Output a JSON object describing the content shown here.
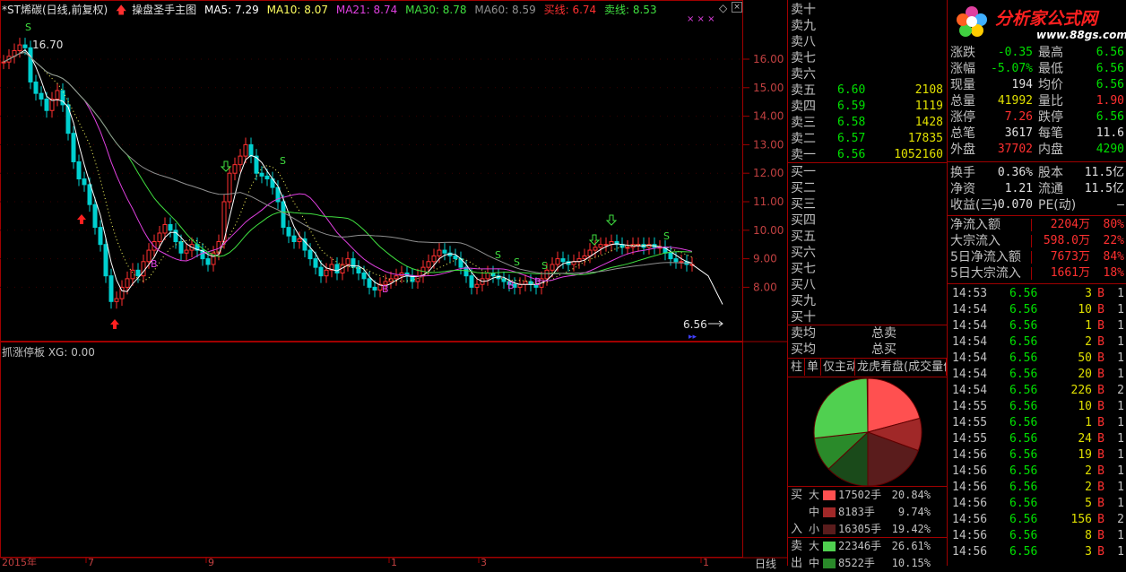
{
  "header": {
    "stock": "*ST烯碳(日线,前复权)",
    "indicator": "操盘圣手主图",
    "ma5": "MA5: 7.29",
    "ma10": "MA10: 8.07",
    "ma21": "MA21: 8.74",
    "ma30": "MA30: 8.78",
    "ma60": "MA60: 8.59",
    "buyline": "买线: 6.74",
    "sellline": "卖线: 8.53",
    "indicator_icon": "arrow-up-icon"
  },
  "sub_header": "抓涨停板  XG: 0.00",
  "price_axis": [
    "16.00",
    "15.00",
    "14.00",
    "13.00",
    "12.00",
    "11.00",
    "10.00",
    "9.00",
    "8.00"
  ],
  "annotations": {
    "high": "16.70",
    "last": "6.56"
  },
  "bottom_labels": {
    "date_left": "2015年",
    "marks": [
      "7",
      "9",
      "1",
      "3",
      "1"
    ],
    "period": "日线"
  },
  "order_book": {
    "sells": [
      {
        "label": "卖十",
        "price": "",
        "vol": ""
      },
      {
        "label": "卖九",
        "price": "",
        "vol": ""
      },
      {
        "label": "卖八",
        "price": "",
        "vol": ""
      },
      {
        "label": "卖七",
        "price": "",
        "vol": ""
      },
      {
        "label": "卖六",
        "price": "",
        "vol": ""
      },
      {
        "label": "卖五",
        "price": "6.60",
        "vol": "2108"
      },
      {
        "label": "卖四",
        "price": "6.59",
        "vol": "1119"
      },
      {
        "label": "卖三",
        "price": "6.58",
        "vol": "1428"
      },
      {
        "label": "卖二",
        "price": "6.57",
        "vol": "17835"
      },
      {
        "label": "卖一",
        "price": "6.56",
        "vol": "1052160"
      }
    ],
    "buys": [
      "买一",
      "买二",
      "买三",
      "买四",
      "买五",
      "买六",
      "买七",
      "买八",
      "买九",
      "买十"
    ],
    "avg_sell": "卖均",
    "avg_buy": "买均",
    "total_sell": "总卖",
    "total_buy": "总买"
  },
  "quote": {
    "rows": [
      {
        "l1": "涨跌",
        "v1": "-0.35",
        "c1": "#00e000",
        "l2": "最高",
        "v2": "6.56",
        "c2": "#00e000"
      },
      {
        "l1": "涨幅",
        "v1": "-5.07%",
        "c1": "#00e000",
        "l2": "最低",
        "v2": "6.56",
        "c2": "#00e000"
      },
      {
        "l1": "现量",
        "v1": "194",
        "c1": "#e0e0e0",
        "l2": "均价",
        "v2": "6.56",
        "c2": "#00e000"
      },
      {
        "l1": "总量",
        "v1": "41992",
        "c1": "#e0e000",
        "l2": "量比",
        "v2": "1.90",
        "c2": "#ff3030"
      },
      {
        "l1": "涨停",
        "v1": "7.26",
        "c1": "#ff3030",
        "l2": "跌停",
        "v2": "6.56",
        "c2": "#00e000"
      },
      {
        "l1": "总笔",
        "v1": "3617",
        "c1": "#e0e0e0",
        "l2": "每笔",
        "v2": "11.6",
        "c2": "#e0e0e0"
      },
      {
        "l1": "外盘",
        "v1": "37702",
        "c1": "#ff3030",
        "l2": "内盘",
        "v2": "4290",
        "c2": "#00e000"
      },
      {
        "l1": "换手",
        "v1": "0.36%",
        "c1": "#e0e0e0",
        "l2": "股本",
        "v2": "11.5亿",
        "c2": "#e0e0e0"
      },
      {
        "l1": "净资",
        "v1": "1.21",
        "c1": "#e0e0e0",
        "l2": "流通",
        "v2": "11.5亿",
        "c2": "#e0e0e0"
      },
      {
        "l1": "收益(三)",
        "v1": "-0.070",
        "c1": "#e0e0e0",
        "l2": "PE(动)",
        "v2": "–",
        "c2": "#e0e0e0"
      }
    ],
    "flows": [
      {
        "label": "净流入额",
        "value": "2204万",
        "pct": "80%"
      },
      {
        "label": "大宗流入",
        "value": "598.0万",
        "pct": "22%"
      },
      {
        "label": "5日净流入额",
        "value": "7673万",
        "pct": "84%"
      },
      {
        "label": "5日大宗流入",
        "value": "1661万",
        "pct": "18%"
      }
    ]
  },
  "logo": {
    "brand": "分析家公式网",
    "url": "www.88gs.com"
  },
  "ticks": [
    {
      "t": "14:53",
      "p": "6.56",
      "v": "3",
      "n": "1"
    },
    {
      "t": "14:54",
      "p": "6.56",
      "v": "10",
      "n": "1"
    },
    {
      "t": "14:54",
      "p": "6.56",
      "v": "1",
      "n": "1"
    },
    {
      "t": "14:54",
      "p": "6.56",
      "v": "2",
      "n": "1"
    },
    {
      "t": "14:54",
      "p": "6.56",
      "v": "50",
      "n": "1"
    },
    {
      "t": "14:54",
      "p": "6.56",
      "v": "20",
      "n": "1"
    },
    {
      "t": "14:54",
      "p": "6.56",
      "v": "226",
      "n": "2"
    },
    {
      "t": "14:55",
      "p": "6.56",
      "v": "10",
      "n": "1"
    },
    {
      "t": "14:55",
      "p": "6.56",
      "v": "1",
      "n": "1"
    },
    {
      "t": "14:55",
      "p": "6.56",
      "v": "24",
      "n": "1"
    },
    {
      "t": "14:56",
      "p": "6.56",
      "v": "19",
      "n": "1"
    },
    {
      "t": "14:56",
      "p": "6.56",
      "v": "2",
      "n": "1"
    },
    {
      "t": "14:56",
      "p": "6.56",
      "v": "2",
      "n": "1"
    },
    {
      "t": "14:56",
      "p": "6.56",
      "v": "5",
      "n": "1"
    },
    {
      "t": "14:56",
      "p": "6.56",
      "v": "156",
      "n": "2"
    },
    {
      "t": "14:56",
      "p": "6.56",
      "v": "8",
      "n": "1"
    },
    {
      "t": "14:56",
      "p": "6.56",
      "v": "3",
      "n": "1"
    }
  ],
  "tick_side": "B",
  "tabs": [
    "柱",
    "单",
    "仅主动",
    "龙虎看盘(成交量依"
  ],
  "pie": [
    {
      "name": "buy-large",
      "pct": 20.84,
      "color": "#ff5050"
    },
    {
      "name": "buy-medium",
      "pct": 9.74,
      "color": "#a02828"
    },
    {
      "name": "buy-small",
      "pct": 19.42,
      "color": "#5a1c1c"
    },
    {
      "name": "sell-small",
      "pct": 13.04,
      "color": "#1a4a1a"
    },
    {
      "name": "sell-medium",
      "pct": 10.15,
      "color": "#2a8a2a"
    },
    {
      "name": "sell-large",
      "pct": 26.61,
      "color": "#50d050"
    }
  ],
  "breakdown": [
    {
      "side": "买",
      "size": "大",
      "vol": "17502手",
      "pct": "20.84%",
      "color": "#ff5050"
    },
    {
      "side": "",
      "size": "中",
      "vol": "8183手",
      "pct": "9.74%",
      "color": "#a02828"
    },
    {
      "side": "入",
      "size": "小",
      "vol": "16305手",
      "pct": "19.42%",
      "color": "#5a1c1c"
    },
    {
      "side": "卖",
      "size": "大",
      "vol": "22346手",
      "pct": "26.61%",
      "color": "#50d050"
    },
    {
      "side": "出",
      "size": "中",
      "vol": "8522手",
      "pct": "10.15%",
      "color": "#2a8a2a"
    }
  ]
}
